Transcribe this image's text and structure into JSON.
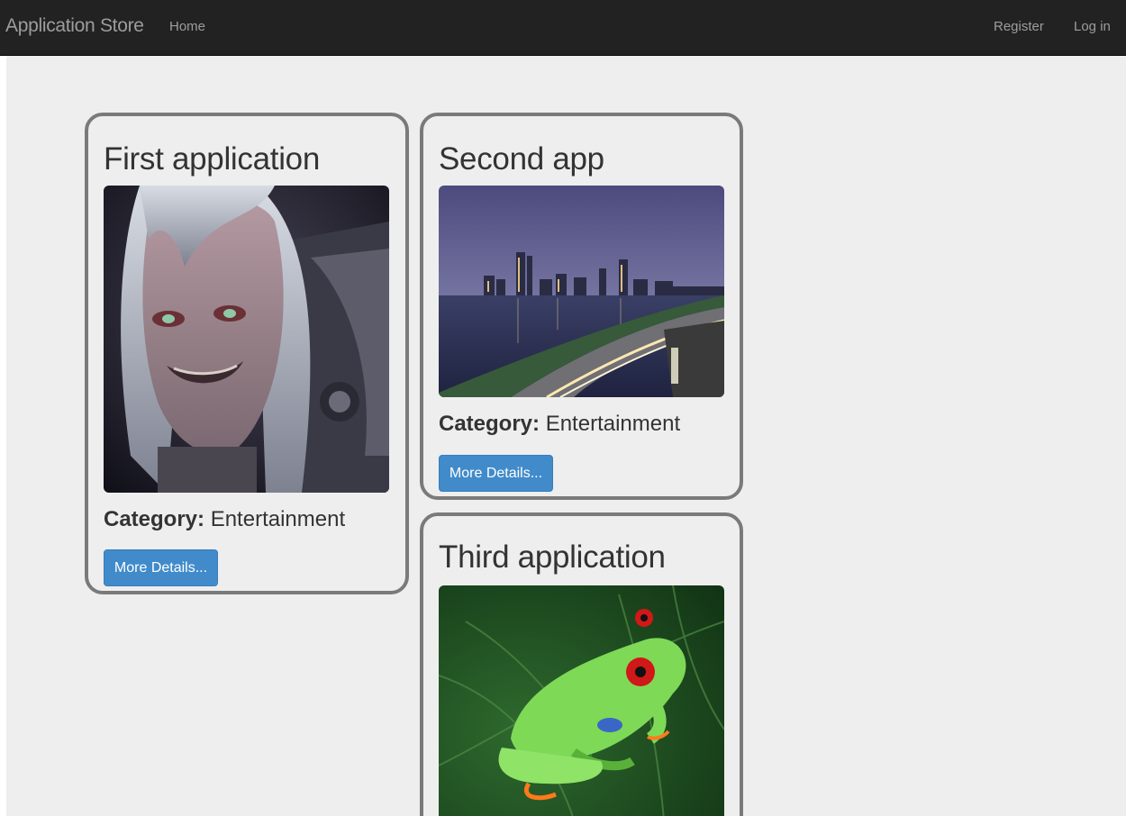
{
  "navbar": {
    "brand": "Application Store",
    "home": "Home",
    "register": "Register",
    "login": "Log in"
  },
  "apps": [
    {
      "title": "First application",
      "category_label": "Category:",
      "category_value": "Entertainment",
      "button": "More Details..."
    },
    {
      "title": "Second app",
      "category_label": "Category:",
      "category_value": "Entertainment",
      "button": "More Details..."
    },
    {
      "title": "Third application"
    }
  ],
  "colors": {
    "navbar_bg": "#222222",
    "nav_text": "#9d9d9d",
    "content_bg": "#eeeeee",
    "card_border": "#7a7a7a",
    "button_bg": "#428bca"
  }
}
